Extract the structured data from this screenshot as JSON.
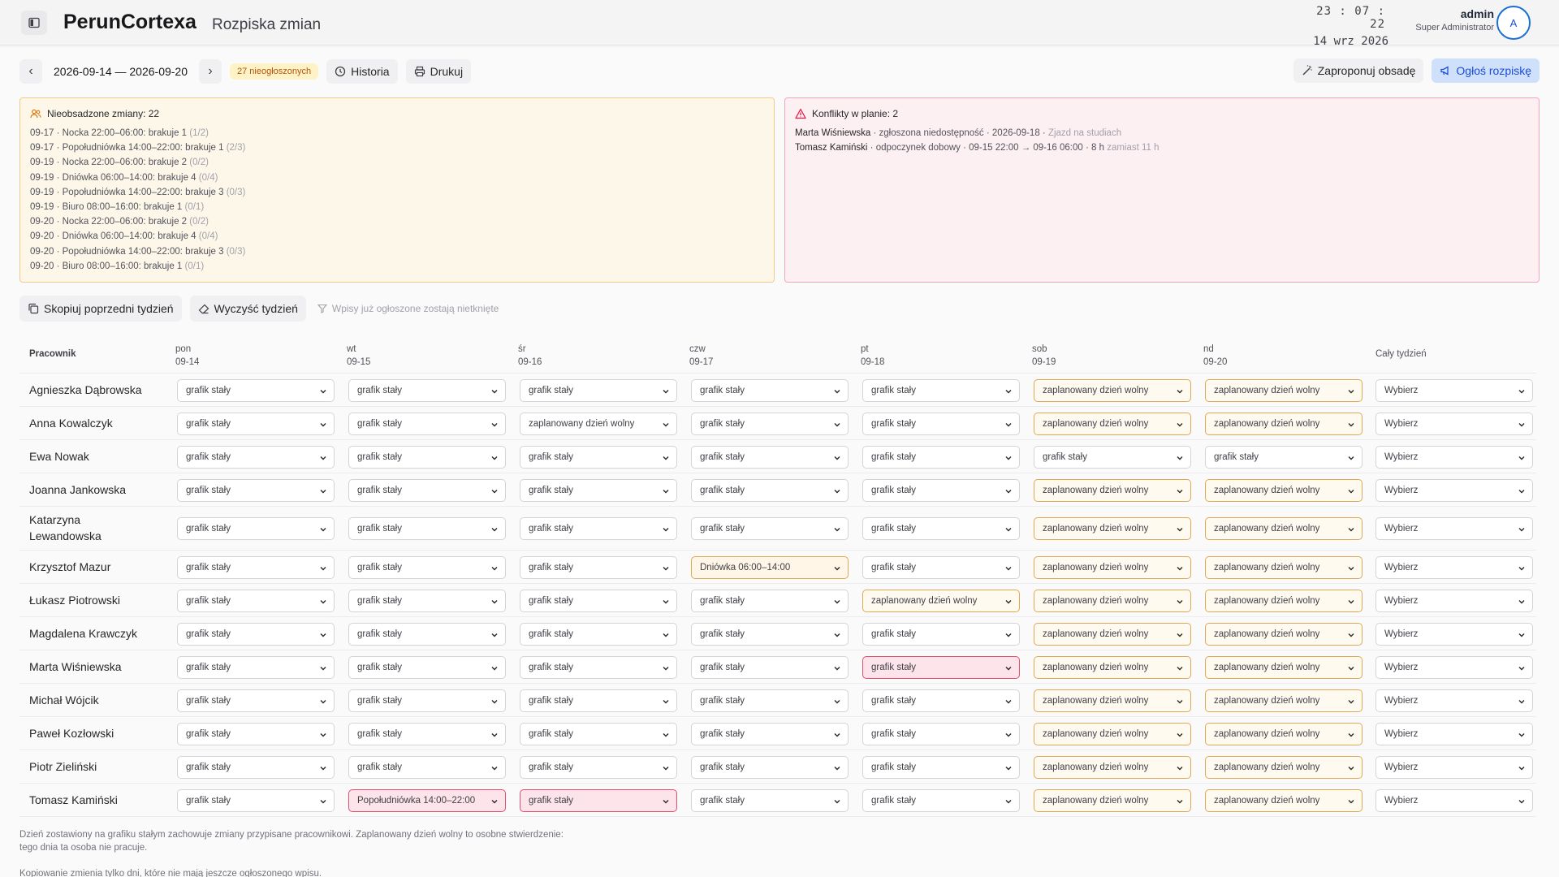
{
  "header": {
    "app_name": "PerunCortexa",
    "page_title": "Rozpiska zmian",
    "clock_time": "23 : 07 : 22",
    "clock_date": "14 wrz 2026",
    "user_name": "admin",
    "user_role": "Super Administrator",
    "avatar_initial": "A"
  },
  "toolbar": {
    "prev": "‹",
    "next": "›",
    "date_range": "2026-09-14 — 2026-09-20",
    "unannounced_badge": "27 nieogłoszonych",
    "history_label": "Historia",
    "print_label": "Drukuj",
    "propose_label": "Zaproponuj obsadę",
    "announce_label": "Ogłoś rozpiskę"
  },
  "unfilled_panel": {
    "title": "Nieobsadzone zmiany: 22",
    "items": [
      {
        "text": "09-17 · Nocka 22:00–06:00: brakuje 1",
        "ratio": "(1/2)"
      },
      {
        "text": "09-17 · Popołudniówka 14:00–22:00: brakuje 1",
        "ratio": "(2/3)"
      },
      {
        "text": "09-19 · Nocka 22:00–06:00: brakuje 2",
        "ratio": "(0/2)"
      },
      {
        "text": "09-19 · Dniówka 06:00–14:00: brakuje 4",
        "ratio": "(0/4)"
      },
      {
        "text": "09-19 · Popołudniówka 14:00–22:00: brakuje 3",
        "ratio": "(0/3)"
      },
      {
        "text": "09-19 · Biuro 08:00–16:00: brakuje 1",
        "ratio": "(0/1)"
      },
      {
        "text": "09-20 · Nocka 22:00–06:00: brakuje 2",
        "ratio": "(0/2)"
      },
      {
        "text": "09-20 · Dniówka 06:00–14:00: brakuje 4",
        "ratio": "(0/4)"
      },
      {
        "text": "09-20 · Popołudniówka 14:00–22:00: brakuje 3",
        "ratio": "(0/3)"
      },
      {
        "text": "09-20 · Biuro 08:00–16:00: brakuje 1",
        "ratio": "(0/1)"
      }
    ]
  },
  "conflicts_panel": {
    "title": "Konflikty w planie: 2",
    "items": [
      {
        "name": "Marta Wiśniewska",
        "text": " · zgłoszona niedostępność · 2026-09-18 · ",
        "muted": "Zjazd na studiach"
      },
      {
        "name": "Tomasz Kamiński",
        "text": " · odpoczynek dobowy · 09-15 22:00 → 09-16 06:00 · 8 h ",
        "muted": "zamiast 11 h"
      }
    ]
  },
  "actions": {
    "copy_label": "Skopiuj poprzedni tydzień",
    "clear_label": "Wyczyść tydzień",
    "note": "Wpisy już ogłoszone zostają nietknięte"
  },
  "grid": {
    "employee_header": "Pracownik",
    "week_header": "Cały tydzień",
    "days": [
      {
        "name": "pon",
        "date": "09-14"
      },
      {
        "name": "wt",
        "date": "09-15"
      },
      {
        "name": "śr",
        "date": "09-16"
      },
      {
        "name": "czw",
        "date": "09-17"
      },
      {
        "name": "pt",
        "date": "09-18"
      },
      {
        "name": "sob",
        "date": "09-19"
      },
      {
        "name": "nd",
        "date": "09-20"
      }
    ],
    "rows": [
      {
        "name": "Agnieszka Dąbrowska",
        "cells": [
          [
            "grafik stały",
            "n"
          ],
          [
            "grafik stały",
            "n"
          ],
          [
            "grafik stały",
            "n"
          ],
          [
            "grafik stały",
            "n"
          ],
          [
            "grafik stały",
            "n"
          ],
          [
            "zaplanowany dzień wolny",
            "f"
          ],
          [
            "zaplanowany dzień wolny",
            "f"
          ]
        ],
        "week": "Wybierz"
      },
      {
        "name": "Anna Kowalczyk",
        "cells": [
          [
            "grafik stały",
            "n"
          ],
          [
            "grafik stały",
            "n"
          ],
          [
            "zaplanowany dzień wolny",
            "n"
          ],
          [
            "grafik stały",
            "n"
          ],
          [
            "grafik stały",
            "n"
          ],
          [
            "zaplanowany dzień wolny",
            "f"
          ],
          [
            "zaplanowany dzień wolny",
            "f"
          ]
        ],
        "week": "Wybierz"
      },
      {
        "name": "Ewa Nowak",
        "cells": [
          [
            "grafik stały",
            "n"
          ],
          [
            "grafik stały",
            "n"
          ],
          [
            "grafik stały",
            "n"
          ],
          [
            "grafik stały",
            "n"
          ],
          [
            "grafik stały",
            "n"
          ],
          [
            "grafik stały",
            "n"
          ],
          [
            "grafik stały",
            "n"
          ]
        ],
        "week": "Wybierz"
      },
      {
        "name": "Joanna Jankowska",
        "cells": [
          [
            "grafik stały",
            "n"
          ],
          [
            "grafik stały",
            "n"
          ],
          [
            "grafik stały",
            "n"
          ],
          [
            "grafik stały",
            "n"
          ],
          [
            "grafik stały",
            "n"
          ],
          [
            "zaplanowany dzień wolny",
            "f"
          ],
          [
            "zaplanowany dzień wolny",
            "f"
          ]
        ],
        "week": "Wybierz"
      },
      {
        "name": "Katarzyna Lewandowska",
        "cells": [
          [
            "grafik stały",
            "n"
          ],
          [
            "grafik stały",
            "n"
          ],
          [
            "grafik stały",
            "n"
          ],
          [
            "grafik stały",
            "n"
          ],
          [
            "grafik stały",
            "n"
          ],
          [
            "zaplanowany dzień wolny",
            "f"
          ],
          [
            "zaplanowany dzień wolny",
            "f"
          ]
        ],
        "week": "Wybierz"
      },
      {
        "name": "Krzysztof Mazur",
        "cells": [
          [
            "grafik stały",
            "n"
          ],
          [
            "grafik stały",
            "n"
          ],
          [
            "grafik stały",
            "n"
          ],
          [
            "Dniówka 06:00–14:00",
            "s"
          ],
          [
            "grafik stały",
            "n"
          ],
          [
            "zaplanowany dzień wolny",
            "f"
          ],
          [
            "zaplanowany dzień wolny",
            "f"
          ]
        ],
        "week": "Wybierz"
      },
      {
        "name": "Łukasz Piotrowski",
        "cells": [
          [
            "grafik stały",
            "n"
          ],
          [
            "grafik stały",
            "n"
          ],
          [
            "grafik stały",
            "n"
          ],
          [
            "grafik stały",
            "n"
          ],
          [
            "zaplanowany dzień wolny",
            "f"
          ],
          [
            "zaplanowany dzień wolny",
            "f"
          ],
          [
            "zaplanowany dzień wolny",
            "f"
          ]
        ],
        "week": "Wybierz"
      },
      {
        "name": "Magdalena Krawczyk",
        "cells": [
          [
            "grafik stały",
            "n"
          ],
          [
            "grafik stały",
            "n"
          ],
          [
            "grafik stały",
            "n"
          ],
          [
            "grafik stały",
            "n"
          ],
          [
            "grafik stały",
            "n"
          ],
          [
            "zaplanowany dzień wolny",
            "f"
          ],
          [
            "zaplanowany dzień wolny",
            "f"
          ]
        ],
        "week": "Wybierz"
      },
      {
        "name": "Marta Wiśniewska",
        "cells": [
          [
            "grafik stały",
            "n"
          ],
          [
            "grafik stały",
            "n"
          ],
          [
            "grafik stały",
            "n"
          ],
          [
            "grafik stały",
            "n"
          ],
          [
            "grafik stały",
            "c"
          ],
          [
            "zaplanowany dzień wolny",
            "f"
          ],
          [
            "zaplanowany dzień wolny",
            "f"
          ]
        ],
        "week": "Wybierz"
      },
      {
        "name": "Michał Wójcik",
        "cells": [
          [
            "grafik stały",
            "n"
          ],
          [
            "grafik stały",
            "n"
          ],
          [
            "grafik stały",
            "n"
          ],
          [
            "grafik stały",
            "n"
          ],
          [
            "grafik stały",
            "n"
          ],
          [
            "zaplanowany dzień wolny",
            "f"
          ],
          [
            "zaplanowany dzień wolny",
            "f"
          ]
        ],
        "week": "Wybierz"
      },
      {
        "name": "Paweł Kozłowski",
        "cells": [
          [
            "grafik stały",
            "n"
          ],
          [
            "grafik stały",
            "n"
          ],
          [
            "grafik stały",
            "n"
          ],
          [
            "grafik stały",
            "n"
          ],
          [
            "grafik stały",
            "n"
          ],
          [
            "zaplanowany dzień wolny",
            "f"
          ],
          [
            "zaplanowany dzień wolny",
            "f"
          ]
        ],
        "week": "Wybierz"
      },
      {
        "name": "Piotr Zieliński",
        "cells": [
          [
            "grafik stały",
            "n"
          ],
          [
            "grafik stały",
            "n"
          ],
          [
            "grafik stały",
            "n"
          ],
          [
            "grafik stały",
            "n"
          ],
          [
            "grafik stały",
            "n"
          ],
          [
            "zaplanowany dzień wolny",
            "f"
          ],
          [
            "zaplanowany dzień wolny",
            "f"
          ]
        ],
        "week": "Wybierz"
      },
      {
        "name": "Tomasz Kamiński",
        "cells": [
          [
            "grafik stały",
            "n"
          ],
          [
            "Popołudniówka 14:00–22:00",
            "c"
          ],
          [
            "grafik stały",
            "c"
          ],
          [
            "grafik stały",
            "n"
          ],
          [
            "grafik stały",
            "n"
          ],
          [
            "zaplanowany dzień wolny",
            "f"
          ],
          [
            "zaplanowany dzień wolny",
            "f"
          ]
        ],
        "week": "Wybierz"
      }
    ]
  },
  "footnote": "Dzień zostawiony na grafiku stałym zachowuje zmiany przypisane pracownikowi. Zaplanowany dzień wolny to osobne stwierdzenie: tego dnia ta osoba nie pracuje.",
  "footnote2": "Kopiowanie zmienia tylko dni, które nie mają jeszcze ogłoszonego wpisu."
}
